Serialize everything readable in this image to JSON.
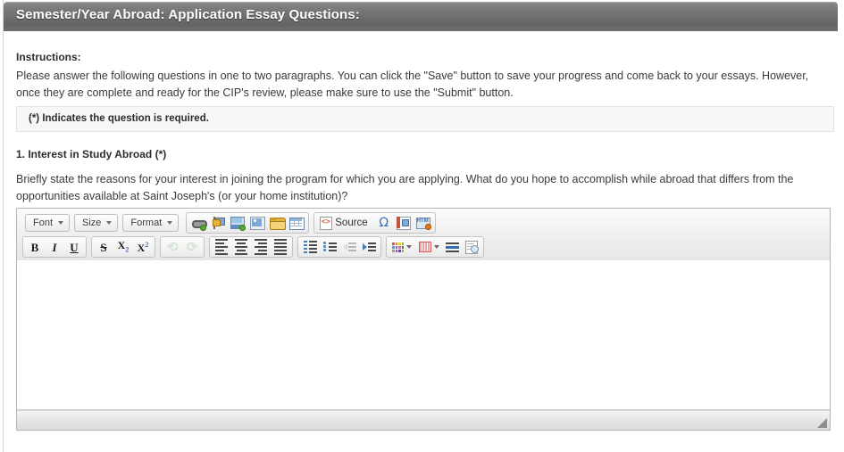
{
  "header": {
    "title": "Semester/Year Abroad: Application Essay Questions:",
    "bg_color": "#6e6e6e",
    "text_color": "#ffffff"
  },
  "instructions": {
    "label": "Instructions:",
    "body": "Please answer the following questions in one to two paragraphs. You can click the \"Save\" button to save your progress and come back to your essays. However, once they are complete and ready for the CIP's review, please make sure to use the \"Submit\" button."
  },
  "required_note": {
    "text": "(*) Indicates the question is required.",
    "bg_color": "#f7f7f7",
    "border_color": "#e2e2e2"
  },
  "question": {
    "number": "1.",
    "title": "1. Interest in Study Abroad  (*)",
    "required_marker": "(*)",
    "prompt": "Briefly state the reasons for your interest in joining the program for which you are applying. What do you hope to accomplish while abroad that differs from the opportunities available at Saint Joseph's (or your home institution)?"
  },
  "editor": {
    "content": "",
    "placeholder": "",
    "toolbar": {
      "row1": {
        "combos": [
          {
            "label": "Font",
            "name": "font-combo"
          },
          {
            "label": "Size",
            "name": "size-combo"
          },
          {
            "label": "Format",
            "name": "format-combo"
          }
        ],
        "insert_group": [
          {
            "icon": "link-icon",
            "label": "Link"
          },
          {
            "icon": "anchor-icon",
            "label": "Anchor"
          },
          {
            "icon": "image-icon",
            "label": "Image"
          },
          {
            "icon": "flash-icon",
            "label": "Flash"
          },
          {
            "icon": "folder-icon",
            "label": "Browse Server"
          },
          {
            "icon": "table-icon",
            "label": "Table"
          }
        ],
        "source_group": [
          {
            "icon": "source-icon",
            "label": "Source"
          },
          {
            "icon": "omega-icon",
            "label": "Ω"
          },
          {
            "icon": "template-icon",
            "label": "Templates"
          },
          {
            "icon": "html-snippet-icon",
            "label": "HTML Snippet"
          }
        ]
      },
      "row2": {
        "basic_styles": [
          {
            "icon": "bold-icon",
            "label": "B"
          },
          {
            "icon": "italic-icon",
            "label": "I"
          },
          {
            "icon": "underline-icon",
            "label": "U"
          }
        ],
        "extra_styles": [
          {
            "icon": "strikethrough-icon",
            "label": "S"
          },
          {
            "icon": "subscript-icon",
            "label": "X"
          },
          {
            "icon": "superscript-icon",
            "label": "X"
          }
        ],
        "history": [
          {
            "icon": "undo-icon",
            "label": "Undo",
            "disabled": true
          },
          {
            "icon": "redo-icon",
            "label": "Redo",
            "disabled": true
          }
        ],
        "alignment": [
          {
            "icon": "align-left-icon",
            "label": "Align Left"
          },
          {
            "icon": "align-center-icon",
            "label": "Center"
          },
          {
            "icon": "align-right-icon",
            "label": "Align Right"
          },
          {
            "icon": "align-justify-icon",
            "label": "Justify"
          }
        ],
        "lists": [
          {
            "icon": "numbered-list-icon",
            "label": "Numbered List"
          },
          {
            "icon": "bulleted-list-icon",
            "label": "Bulleted List"
          },
          {
            "icon": "outdent-icon",
            "label": "Decrease Indent",
            "disabled": true
          },
          {
            "icon": "indent-icon",
            "label": "Increase Indent"
          }
        ],
        "colors": [
          {
            "icon": "text-color-icon",
            "label": "Text Color"
          },
          {
            "icon": "background-color-icon",
            "label": "Background Color"
          },
          {
            "icon": "horizontal-rule-icon",
            "label": "Horizontal Line"
          },
          {
            "icon": "preview-icon",
            "label": "Preview"
          }
        ]
      }
    },
    "footer": {
      "path": "",
      "resize_grip": "resize-grip-icon"
    }
  }
}
